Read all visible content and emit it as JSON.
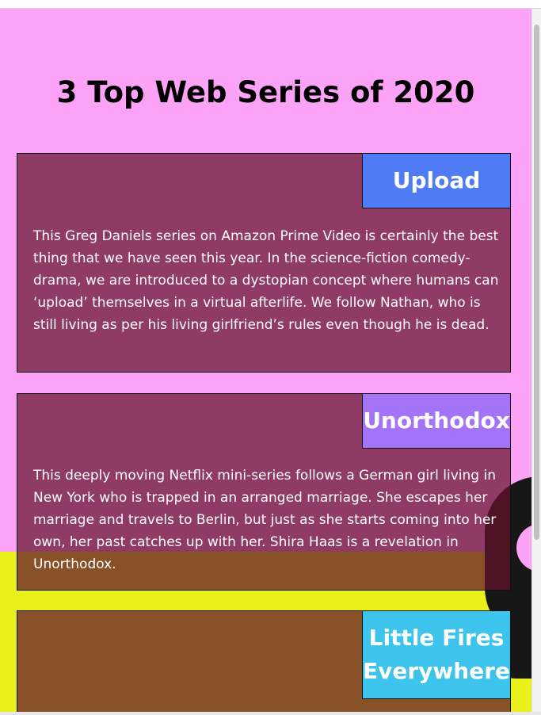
{
  "page": {
    "title": "3 Top Web Series of 2020"
  },
  "cards": [
    {
      "heading": "Upload",
      "heading_color": "#4f7cf5",
      "text": "This Greg Daniels series on Amazon Prime Video is certainly the best thing that we have seen this year. In the science-fiction comedy-drama, we are introduced to a dystopian concept where humans can ‘upload’ themselves in a virtual afterlife. We follow Nathan, who is still living as per his living girlfriend’s rules even though he is dead."
    },
    {
      "heading": "Unorthodox",
      "heading_color": "#a374f7",
      "text": "This deeply moving Netflix mini-series follows a German girl living in New York who is trapped in an arranged marriage. She escapes her marriage and travels to Berlin, but just as she starts coming into her own, her past catches up with her. Shira Haas is a revelation in Unorthodox."
    },
    {
      "heading": "Little Fires Everywhere",
      "heading_color": "#3cc4ec",
      "text": ""
    }
  ],
  "colors": {
    "background_pink": "#fda3f7",
    "background_yellow": "#e9f01a",
    "card_overlay": "#8a4a5c"
  }
}
